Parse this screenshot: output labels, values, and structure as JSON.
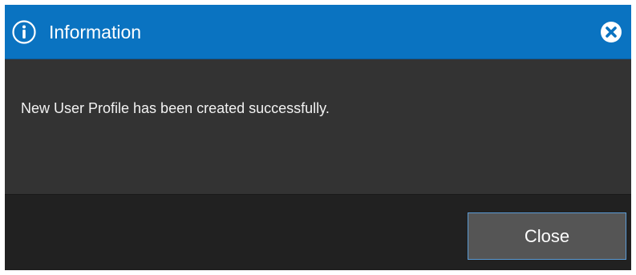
{
  "dialog": {
    "title": "Information",
    "message": "New User Profile has been created successfully.",
    "close_button_label": "Close",
    "title_icon": "info-icon",
    "title_close_icon": "close-circle-icon"
  },
  "colors": {
    "titlebar": "#0a73c1",
    "body": "#333333",
    "footer": "#212121",
    "button": "#555555",
    "button_border": "#5b9bd5",
    "text": "#ffffff"
  }
}
